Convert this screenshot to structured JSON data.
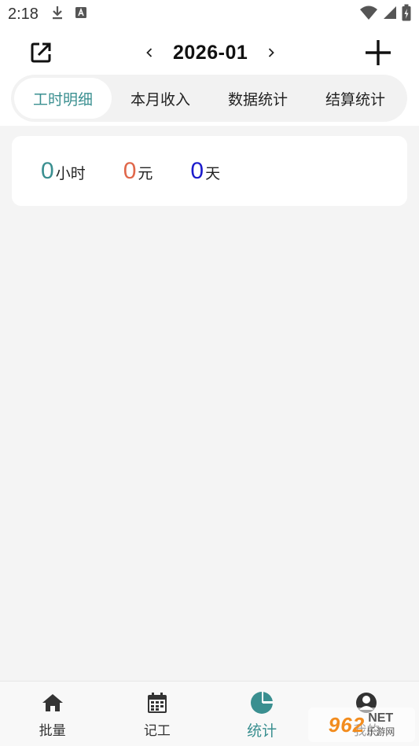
{
  "status_bar": {
    "time": "2:18",
    "icons": [
      "download-icon",
      "keyboard-a-icon",
      "wifi-icon",
      "signal-icon",
      "battery-icon"
    ]
  },
  "header": {
    "month": "2026-01",
    "prev_icon": "chevron-left-icon",
    "next_icon": "chevron-right-icon",
    "export_icon": "share-export-icon",
    "add_icon": "plus-icon"
  },
  "tabs": [
    {
      "label": "工时明细",
      "active": true
    },
    {
      "label": "本月收入",
      "active": false
    },
    {
      "label": "数据统计",
      "active": false
    },
    {
      "label": "结算统计",
      "active": false
    }
  ],
  "summary": {
    "hours": {
      "value": "0",
      "unit": "小时",
      "color": "#3a8f90"
    },
    "money": {
      "value": "0",
      "unit": "元",
      "color": "#e0674a"
    },
    "days": {
      "value": "0",
      "unit": "天",
      "color": "#1c1ccc"
    }
  },
  "bottom_nav": [
    {
      "label": "批量",
      "icon": "home-icon",
      "active": false
    },
    {
      "label": "记工",
      "icon": "calendar-icon",
      "active": false
    },
    {
      "label": "统计",
      "icon": "pie-chart-icon",
      "active": true
    },
    {
      "label": "我的",
      "icon": "user-icon",
      "active": false
    }
  ],
  "watermark": {
    "main": "962",
    "net": "NET",
    "sub": "乐游网"
  },
  "colors": {
    "accent": "#3a8f90",
    "background": "#f4f4f4"
  }
}
